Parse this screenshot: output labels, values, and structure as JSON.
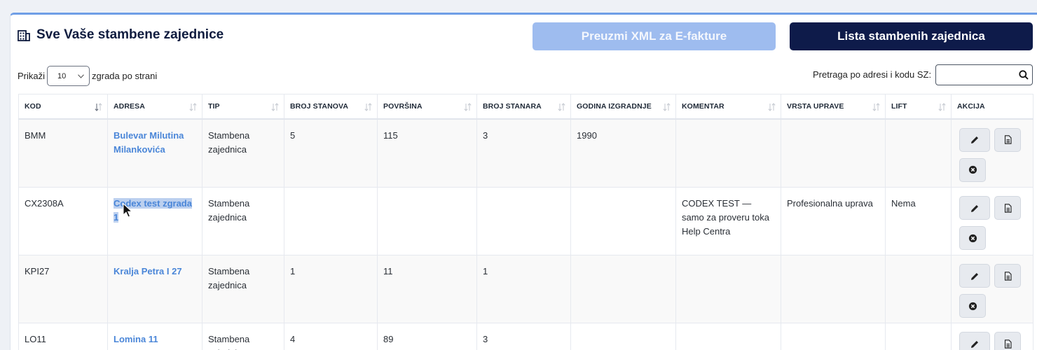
{
  "header": {
    "title": "Sve Vaše stambene zajednice",
    "xml_button": "Preuzmi XML za E-fakture",
    "list_button": "Lista stambenih zajednica"
  },
  "controls": {
    "show_label": "Prikaži",
    "page_size": "10",
    "per_page_label": "zgrada po strani",
    "search_label": "Pretraga po adresi i kodu SZ:",
    "search_value": ""
  },
  "table": {
    "columns": [
      "KOD",
      "ADRESA",
      "TIP",
      "BROJ STANOVA",
      "POVRŠINA",
      "BROJ STANARA",
      "GODINA IZGRADNJE",
      "KOMENTAR",
      "VRSTA UPRAVE",
      "LIFT",
      "AKCIJA"
    ],
    "rows": [
      {
        "kod": "BMM",
        "adresa": "Bulevar Milutina Milankovića",
        "tip": "Stambena zajednica",
        "stanova": "5",
        "povrsina": "115",
        "stanara": "3",
        "godina": "1990",
        "komentar": "",
        "uprava": "",
        "lift": ""
      },
      {
        "kod": "CX2308A",
        "adresa": "Codex test zgrada 1",
        "tip": "Stambena zajednica",
        "stanova": "",
        "povrsina": "",
        "stanara": "",
        "godina": "",
        "komentar": "CODEX TEST — samo za proveru toka Help Centra",
        "uprava": "Profesionalna uprava",
        "lift": "Nema"
      },
      {
        "kod": "KPI27",
        "adresa": "Kralja Petra I 27",
        "tip": "Stambena zajednica",
        "stanova": "1",
        "povrsina": "11",
        "stanara": "1",
        "godina": "",
        "komentar": "",
        "uprava": "",
        "lift": ""
      },
      {
        "kod": "LO11",
        "adresa": "Lomina 11",
        "tip": "Stambena zajednica",
        "stanova": "4",
        "povrsina": "89",
        "stanara": "3",
        "godina": "",
        "komentar": "",
        "uprava": "",
        "lift": ""
      }
    ]
  },
  "icons": {
    "title": "building-icon",
    "edit": "pencil-icon",
    "document": "document-icon",
    "delete": "close-circle-icon",
    "search": "search-icon",
    "sort": "sort-icon"
  },
  "colors": {
    "link": "#4a86d8",
    "primary_button": "#0e1b4a",
    "disabled_button": "#9ebcef",
    "selection": "#bcd0ef"
  }
}
